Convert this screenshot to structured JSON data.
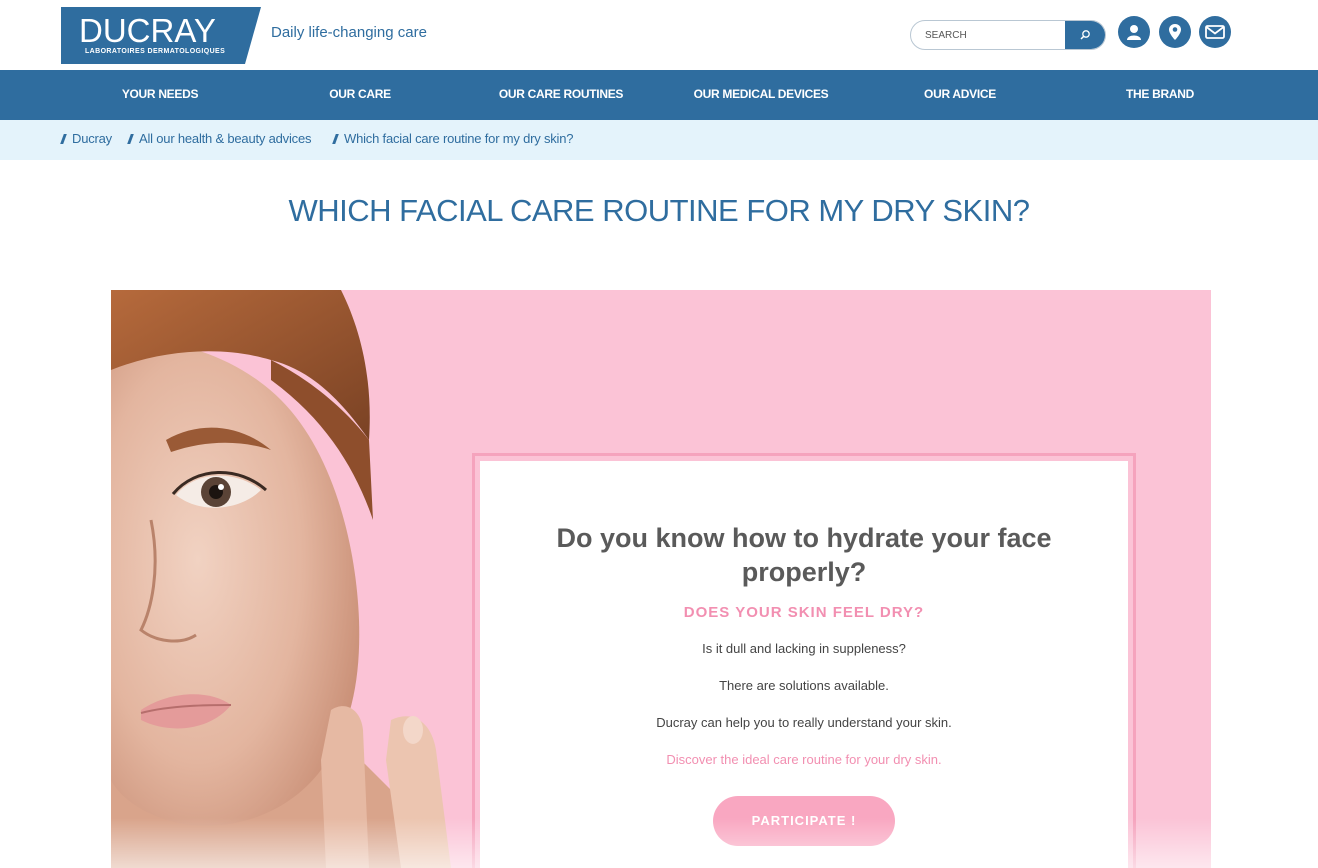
{
  "header": {
    "logo_main": "DUCRAY",
    "logo_sub": "LABORATOIRES DERMATOLOGIQUES",
    "tagline": "Daily life-changing care",
    "search_placeholder": "SEARCH",
    "icons": [
      "search-icon",
      "user-icon",
      "location-pin-icon",
      "mail-icon"
    ]
  },
  "nav": {
    "items": [
      "YOUR NEEDS",
      "OUR CARE",
      "OUR CARE ROUTINES",
      "OUR MEDICAL DEVICES",
      "OUR ADVICE",
      "THE BRAND"
    ]
  },
  "breadcrumb": [
    "Ducray",
    "All our health & beauty advices",
    "Which facial care routine for my dry skin?"
  ],
  "page": {
    "title": "WHICH FACIAL CARE ROUTINE FOR MY DRY SKIN?"
  },
  "card": {
    "title": "Do you know how to hydrate your face properly?",
    "subtitle": "DOES YOUR SKIN FEEL DRY?",
    "lines": [
      "Is it dull and lacking in suppleness?",
      "There are solutions available.",
      "Ducray can help you to really understand your skin."
    ],
    "link": "Discover the ideal care routine for your dry skin.",
    "cta": "PARTICIPATE !"
  },
  "colors": {
    "brand_blue": "#2f6d9f",
    "breadcrumb_bg": "#e4f3fb",
    "hero_pink": "#fbc3d6",
    "accent_pink": "#f28fb1"
  }
}
